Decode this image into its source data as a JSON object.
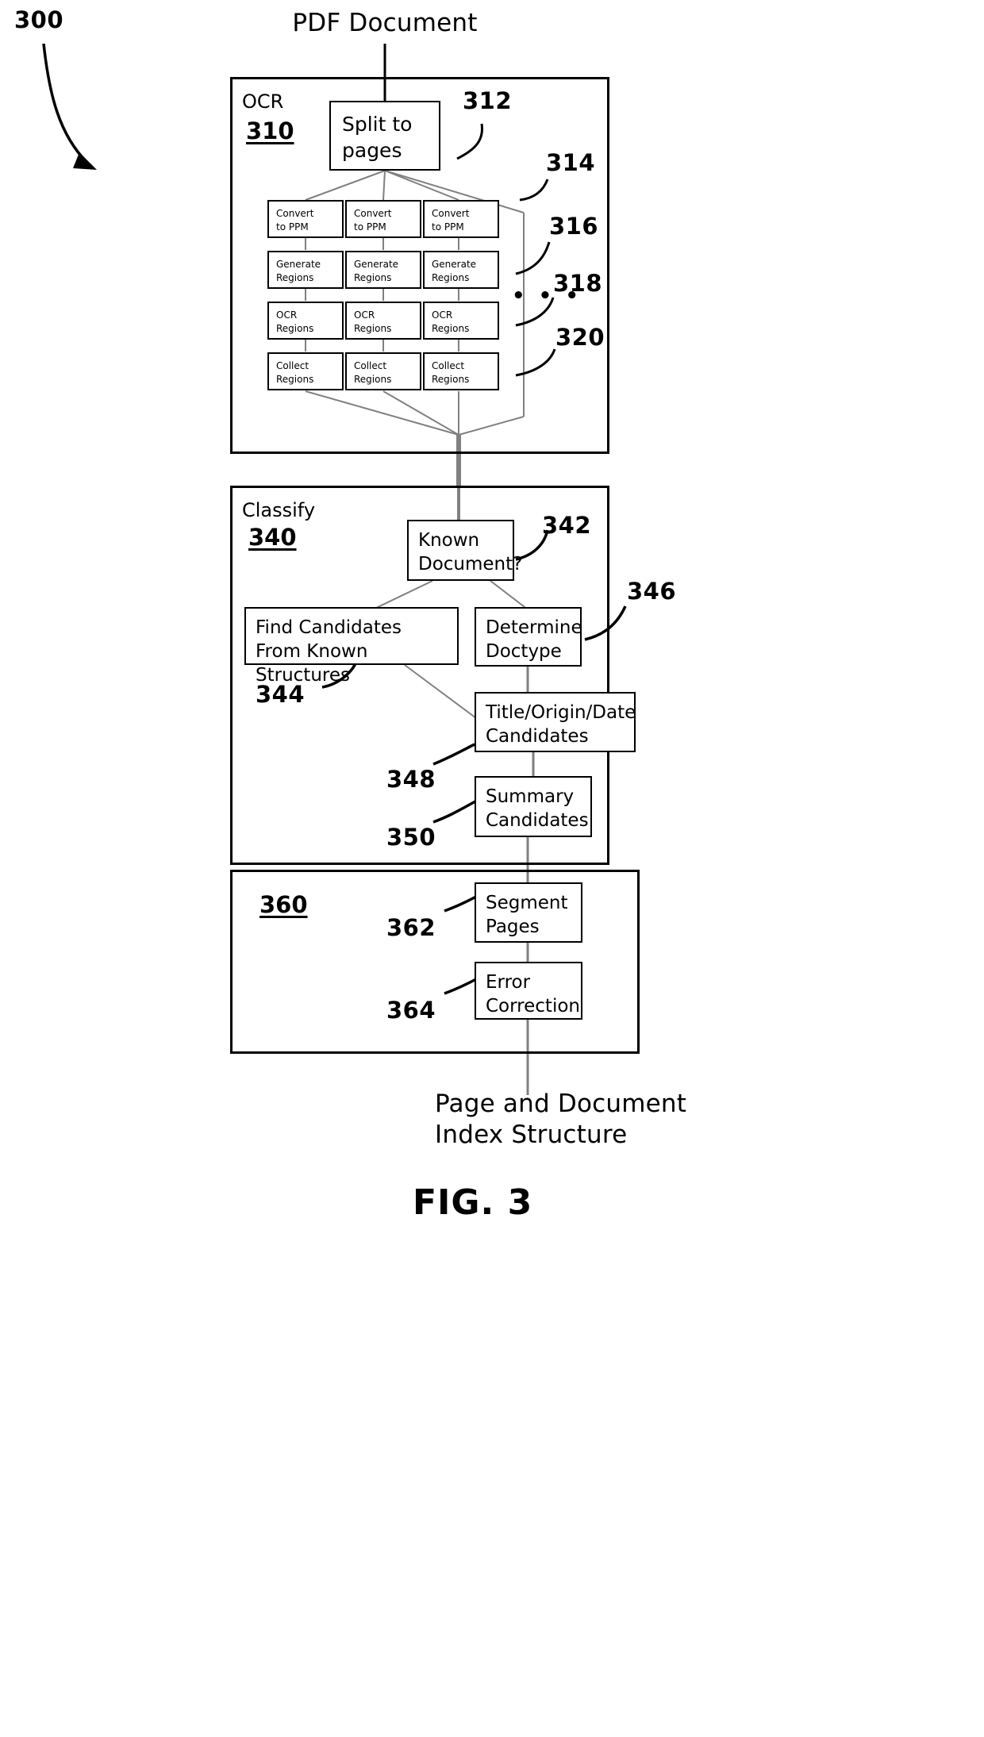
{
  "figure": {
    "number_label": "300",
    "caption": "FIG. 3",
    "input_label": "PDF Document",
    "output_label": "Page and Document\nIndex Structure"
  },
  "sections": [
    {
      "id": "ocr",
      "title": "OCR",
      "ref": "310"
    },
    {
      "id": "classify",
      "title": "Classify",
      "ref": "340"
    },
    {
      "id": "segment",
      "title": "",
      "ref": "360"
    }
  ],
  "ocr": {
    "split_box": "Split to\npages",
    "split_ref": "312",
    "column_count": 3,
    "ellipsis": "• • •",
    "stages": [
      {
        "label": "Convert\nto PPM",
        "ref": "314"
      },
      {
        "label": "Generate\nRegions",
        "ref": "316"
      },
      {
        "label": "OCR\nRegions",
        "ref": "318"
      },
      {
        "label": "Collect\nRegions",
        "ref": "320"
      }
    ]
  },
  "classify": {
    "known_document": {
      "label": "Known\nDocument?",
      "ref": "342"
    },
    "find_candidates": {
      "label": "Find Candidates\nFrom Known Structures",
      "ref": "344"
    },
    "determine_doctype": {
      "label": "Determine\nDoctype",
      "ref": "346"
    },
    "title_origin_date": {
      "label": "Title/Origin/Date\nCandidates",
      "ref": "348"
    },
    "summary_candidates": {
      "label": "Summary\nCandidates",
      "ref": "350"
    }
  },
  "segment": {
    "segment_pages": {
      "label": "Segment\nPages",
      "ref": "362"
    },
    "error_correction": {
      "label": "Error\nCorrection",
      "ref": "364"
    }
  },
  "colors": {
    "ink": "#000000",
    "paper": "#ffffff",
    "connector_gray": "#808080"
  }
}
